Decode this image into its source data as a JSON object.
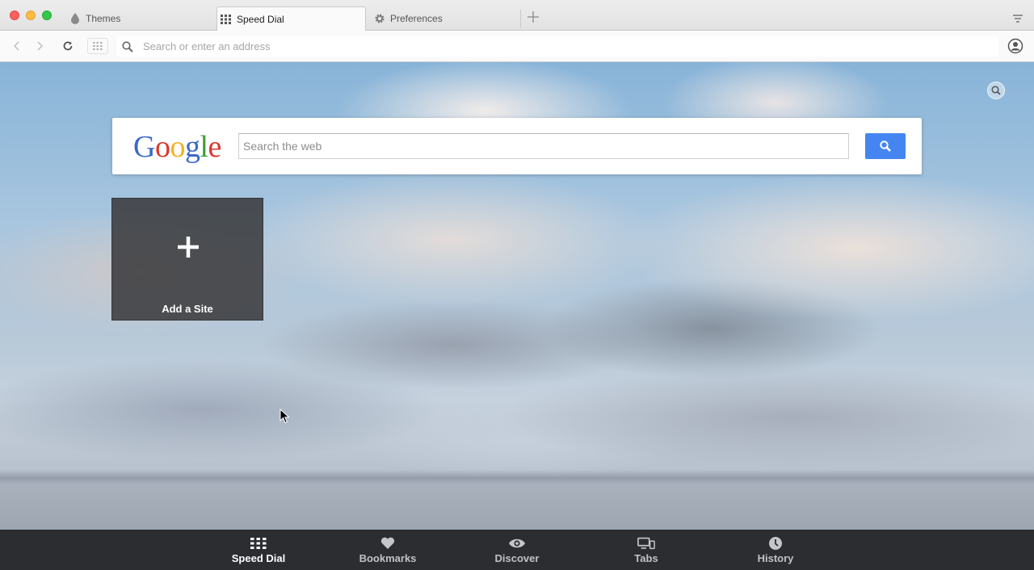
{
  "tabs": [
    {
      "label": "Themes",
      "icon": "droplet-icon"
    },
    {
      "label": "Speed Dial",
      "icon": "grid-icon",
      "active": true
    },
    {
      "label": "Preferences",
      "icon": "gear-icon"
    }
  ],
  "addressbar": {
    "placeholder": "Search or enter an address"
  },
  "google": {
    "logo_letters": [
      "G",
      "o",
      "o",
      "g",
      "l",
      "e"
    ],
    "search_placeholder": "Search the web"
  },
  "speed_dial": {
    "add_site_label": "Add a Site"
  },
  "bottom_bar": {
    "items": [
      {
        "label": "Speed Dial",
        "icon": "grid-icon",
        "active": true
      },
      {
        "label": "Bookmarks",
        "icon": "heart-icon"
      },
      {
        "label": "Discover",
        "icon": "eye-icon"
      },
      {
        "label": "Tabs",
        "icon": "devices-icon"
      },
      {
        "label": "History",
        "icon": "clock-icon"
      }
    ]
  },
  "colors": {
    "accent_blue": "#4585f2",
    "bottom_bar_bg": "#2b2d31"
  }
}
